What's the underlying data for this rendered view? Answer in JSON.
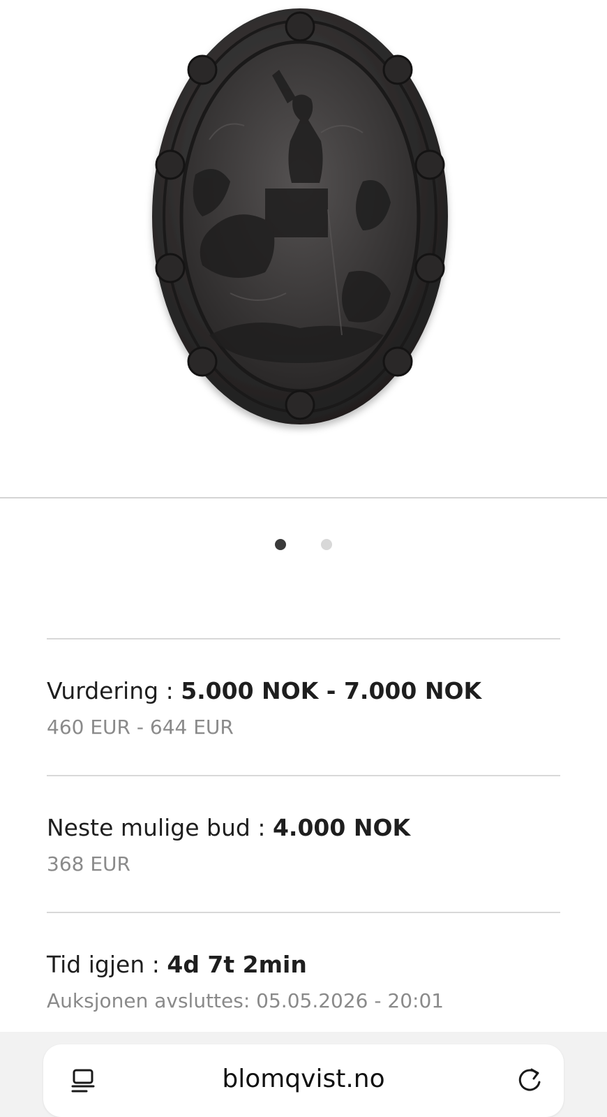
{
  "gallery": {
    "image_description_icon": "relief-plaque-image",
    "slide_count": 2,
    "active_slide": 1
  },
  "estimate": {
    "label": "Vurdering : ",
    "value": "5.000 NOK - 7.000 NOK",
    "sub": "460 EUR - 644 EUR"
  },
  "next_bid": {
    "label": "Neste mulige bud : ",
    "value": "4.000 NOK",
    "sub": "368 EUR"
  },
  "time_left": {
    "label": "Tid igjen : ",
    "value": "4d 7t 2min",
    "sub": "Auksjonen avsluttes: 05.05.2026 - 20:01"
  },
  "browser": {
    "url": "blomqvist.no",
    "left_icon": "tabs-icon",
    "right_icon": "reload-icon"
  },
  "colors": {
    "text": "#1e1e1e",
    "subtext": "#8a8a8a",
    "divider": "#d8d8d8",
    "dot_active": "#3a3a3a",
    "dot_inactive": "#d8d8d8"
  }
}
